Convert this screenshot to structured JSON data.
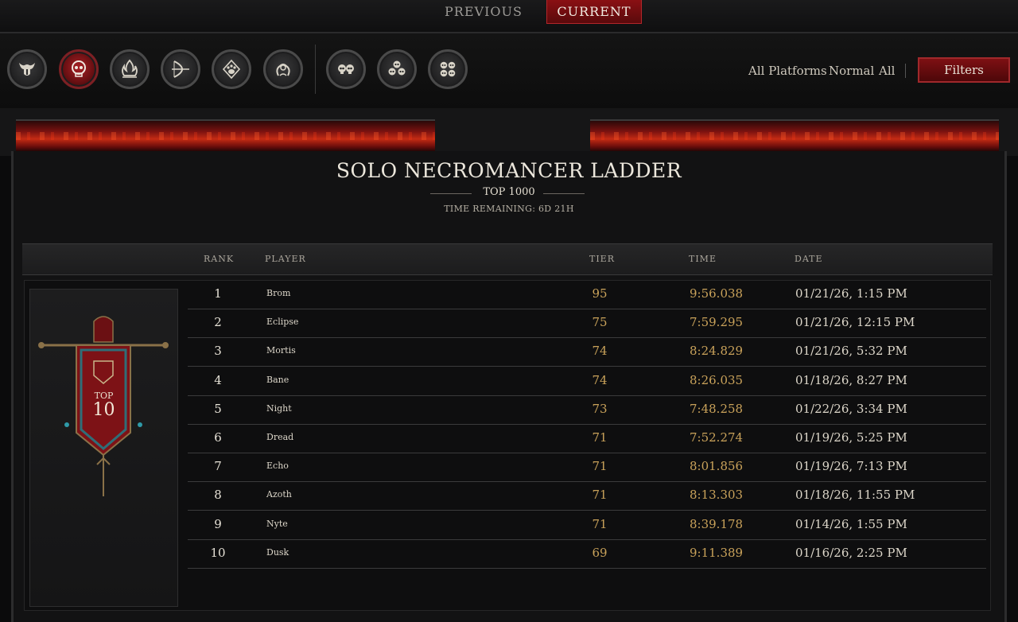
{
  "tabs": {
    "previous": "PREVIOUS",
    "current": "CURRENT"
  },
  "classes": [
    {
      "name": "barbarian",
      "icon": "horned-helm-icon",
      "active": false
    },
    {
      "name": "necromancer",
      "icon": "skull-icon",
      "active": true
    },
    {
      "name": "sorcerer",
      "icon": "flame-icon",
      "active": false
    },
    {
      "name": "rogue",
      "icon": "bow-icon",
      "active": false
    },
    {
      "name": "druid",
      "icon": "paw-icon",
      "active": false
    },
    {
      "name": "spiritborn",
      "icon": "serpent-icon",
      "active": false
    },
    {
      "name": "duo",
      "icon": "two-skulls-icon",
      "active": false
    },
    {
      "name": "trio",
      "icon": "three-skulls-icon",
      "active": false
    },
    {
      "name": "quad",
      "icon": "four-skulls-icon",
      "active": false
    }
  ],
  "filters": {
    "platform": "All Platforms",
    "mode": "Normal",
    "scope": "All",
    "button_label": "Filters"
  },
  "ladder": {
    "title": "SOLO NECROMANCER LADDER",
    "subtitle": "TOP 1000",
    "time_remaining": "TIME REMAINING: 6D 21H"
  },
  "table": {
    "headers": {
      "rank": "RANK",
      "player": "PLAYER",
      "tier": "TIER",
      "time": "TIME",
      "date": "DATE"
    },
    "rows": [
      {
        "rank": "1",
        "player": "Brom",
        "tier": "95",
        "time": "9:56.038",
        "date": "01/21/26, 1:15 PM"
      },
      {
        "rank": "2",
        "player": "Eclipse",
        "tier": "75",
        "time": "7:59.295",
        "date": "01/21/26, 12:15 PM"
      },
      {
        "rank": "3",
        "player": "Mortis",
        "tier": "74",
        "time": "8:24.829",
        "date": "01/21/26, 5:32 PM"
      },
      {
        "rank": "4",
        "player": "Bane",
        "tier": "74",
        "time": "8:26.035",
        "date": "01/18/26, 8:27 PM"
      },
      {
        "rank": "5",
        "player": "Night",
        "tier": "73",
        "time": "7:48.258",
        "date": "01/22/26, 3:34 PM"
      },
      {
        "rank": "6",
        "player": "Dread",
        "tier": "71",
        "time": "7:52.274",
        "date": "01/19/26, 5:25 PM"
      },
      {
        "rank": "7",
        "player": "Echo",
        "tier": "71",
        "time": "8:01.856",
        "date": "01/19/26, 7:13 PM"
      },
      {
        "rank": "8",
        "player": "Azoth",
        "tier": "71",
        "time": "8:13.303",
        "date": "01/18/26, 11:55 PM"
      },
      {
        "rank": "9",
        "player": "Nyte",
        "tier": "71",
        "time": "8:39.178",
        "date": "01/14/26, 1:55 PM"
      },
      {
        "rank": "10",
        "player": "Dusk",
        "tier": "69",
        "time": "9:11.389",
        "date": "01/16/26, 2:25 PM"
      }
    ]
  },
  "badge": {
    "label": "TOP",
    "number": "10"
  },
  "colors": {
    "accent_red": "#8a1013",
    "gold": "#c9a25a",
    "lava": "#c42b14"
  }
}
